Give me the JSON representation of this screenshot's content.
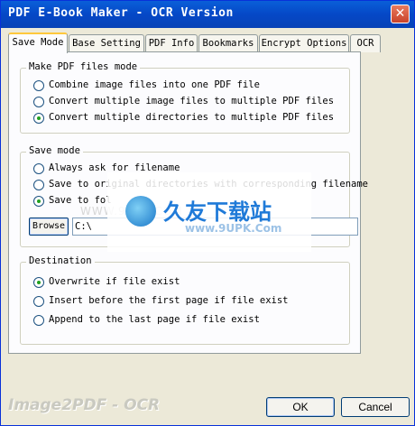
{
  "window": {
    "title": "PDF E-Book Maker - OCR Version",
    "close_glyph": "✕"
  },
  "tabs": [
    "Save Mode",
    "Base Setting",
    "PDF Info",
    "Bookmarks",
    "Encrypt Options",
    "OCR"
  ],
  "make_mode": {
    "legend": "Make PDF files mode",
    "options": [
      "Combine image files into one PDF file",
      "Convert multiple image files to multiple PDF files",
      "Convert multiple directories to multiple PDF files"
    ],
    "selected": 2
  },
  "save_mode": {
    "legend": "Save mode",
    "options": [
      "Always ask for filename",
      "Save to original directories with corresponding filename",
      "Save to fol"
    ],
    "selected": 2,
    "browse_label": "Browse",
    "path_value": "C:\\"
  },
  "destination": {
    "legend": "Destination",
    "options": [
      "Overwrite if file exist",
      "Insert before the first page if file exist",
      "Append to the last page if file exist"
    ],
    "selected": 0
  },
  "watermark": {
    "cn_text": "久友下载站",
    "url": "www.9UPK.Com",
    "url_side": "WWW.9UPK.COM"
  },
  "footer": {
    "brand": "Image2PDF - OCR",
    "ok_label": "OK",
    "cancel_label": "Cancel"
  }
}
